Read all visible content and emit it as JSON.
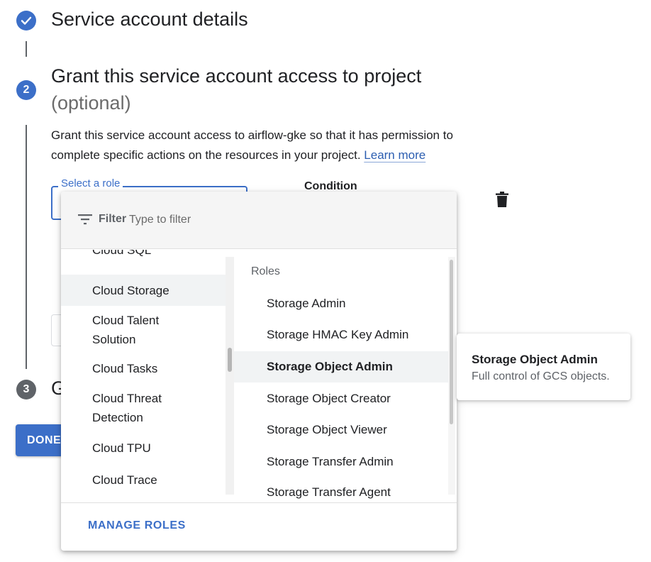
{
  "stepper": {
    "step1": {
      "title": "Service account details",
      "icon": "check-icon"
    },
    "step2": {
      "number": "2",
      "title": "Grant this service account access to project",
      "optional": "(optional)",
      "description": "Grant this service account access to airflow-gke so that it has permission to complete specific actions on the resources in your project. ",
      "learn_more": "Learn more"
    },
    "step3": {
      "number": "3",
      "title": "G"
    }
  },
  "role_field": {
    "label": "Select a role",
    "condition_label": "Condition"
  },
  "done_button": "DONE",
  "dropdown": {
    "filter": {
      "label": "Filter",
      "placeholder": "Type to filter",
      "value": ""
    },
    "categories": [
      "Cloud SQL",
      "Cloud Storage",
      "Cloud Talent Solution",
      "Cloud Tasks",
      "Cloud Threat Detection",
      "Cloud TPU",
      "Cloud Trace"
    ],
    "selected_category": "Cloud Storage",
    "roles_header": "Roles",
    "roles": [
      "Storage Admin",
      "Storage HMAC Key Admin",
      "Storage Object Admin",
      "Storage Object Creator",
      "Storage Object Viewer",
      "Storage Transfer Admin",
      "Storage Transfer Agent"
    ],
    "highlighted_role": "Storage Object Admin",
    "manage_roles": "MANAGE ROLES"
  },
  "tooltip": {
    "title": "Storage Object Admin",
    "description": "Full control of GCS objects."
  },
  "colors": {
    "accent": "#3c6fc8",
    "inactive_step": "#5f6368",
    "highlight_bg": "#f1f3f4"
  }
}
